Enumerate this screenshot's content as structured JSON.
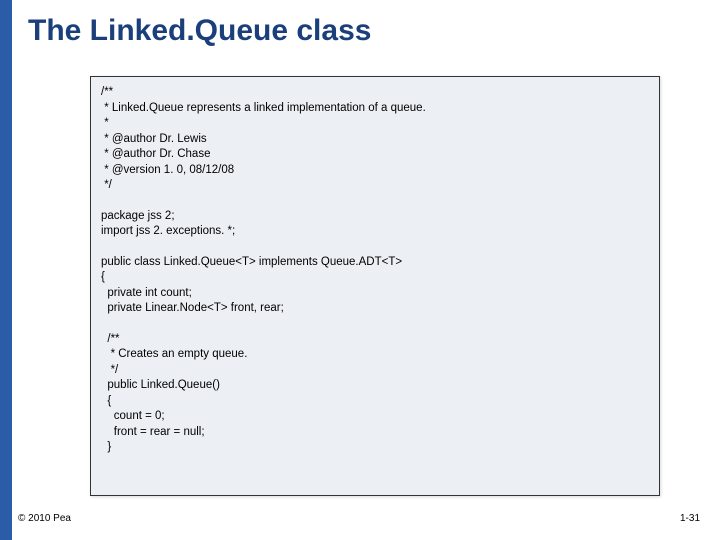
{
  "title": "The Linked.Queue class",
  "code": [
    "/**",
    " * Linked.Queue represents a linked implementation of a queue.",
    " *",
    " * @author Dr. Lewis",
    " * @author Dr. Chase",
    " * @version 1. 0, 08/12/08",
    " */",
    "",
    "package jss 2;",
    "import jss 2. exceptions. *;",
    "",
    "public class Linked.Queue<T> implements Queue.ADT<T>",
    "{",
    "  private int count;",
    "  private Linear.Node<T> front, rear;",
    "",
    "  /**",
    "   * Creates an empty queue.",
    "   */",
    "  public Linked.Queue()",
    "  {",
    "    count = 0;",
    "    front = rear = null;",
    "  }"
  ],
  "copyright": "© 2010 Pea",
  "pageNumber": "1-31"
}
